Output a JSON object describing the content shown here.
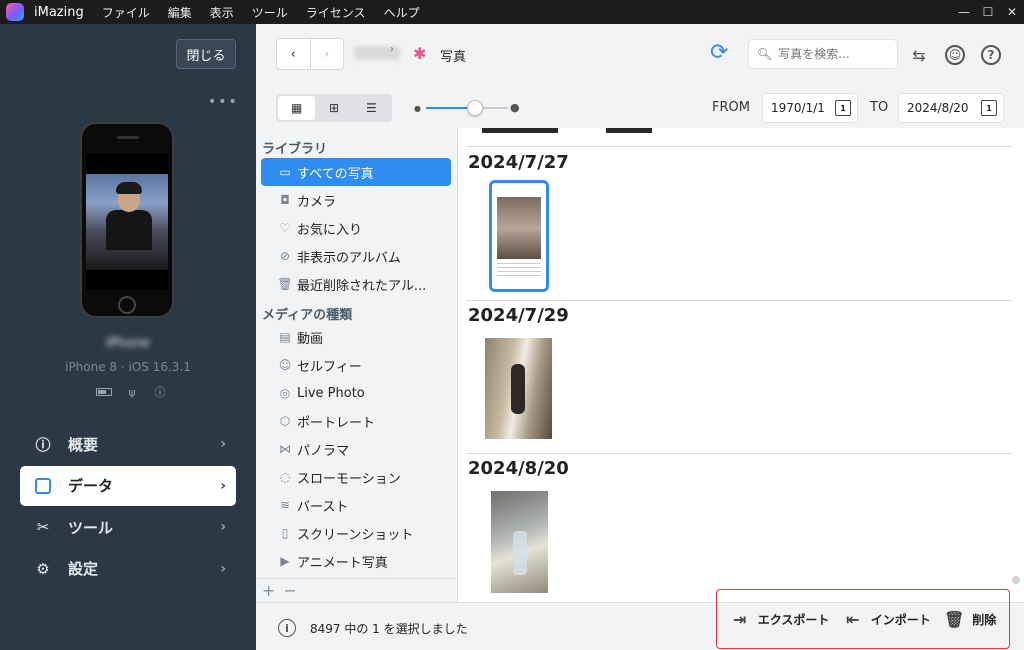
{
  "titlebar": {
    "app_name": "iMazing",
    "menu": [
      "ファイル",
      "編集",
      "表示",
      "ツール",
      "ライセンス",
      "ヘルプ"
    ]
  },
  "sidebar": {
    "close_label": "閉じる",
    "more_label": "•••",
    "device_name": "iPhone",
    "device_model": "iPhone 8 · iOS 16.3.1",
    "nav": [
      {
        "label": "概要",
        "icon": "info-icon"
      },
      {
        "label": "データ",
        "icon": "square-icon"
      },
      {
        "label": "ツール",
        "icon": "tools-icon"
      },
      {
        "label": "設定",
        "icon": "gear-icon"
      }
    ]
  },
  "toolbar": {
    "back": "‹",
    "forward": "›",
    "crumb_sep": "›",
    "crumb_title": "写真",
    "search_placeholder": "写真を検索..."
  },
  "filters": {
    "from_label": "FROM",
    "from_date": "1970/1/1",
    "to_label": "TO",
    "to_date": "2024/8/20",
    "calendar_day": "1",
    "zoom_fraction": 0.6
  },
  "albums": {
    "library_title": "ライブラリ",
    "library": [
      {
        "label": "すべての写真",
        "icon": "photo-icon"
      },
      {
        "label": "カメラ",
        "icon": "camera-icon"
      },
      {
        "label": "お気に入り",
        "icon": "heart-icon"
      },
      {
        "label": "非表示のアルバム",
        "icon": "eye-slash-icon"
      },
      {
        "label": "最近削除されたアル...",
        "icon": "trash-icon"
      }
    ],
    "media_title": "メディアの種類",
    "media": [
      {
        "label": "動画",
        "icon": "video-icon"
      },
      {
        "label": "セルフィー",
        "icon": "selfie-icon"
      },
      {
        "label": "Live Photo",
        "icon": "live-photo-icon"
      },
      {
        "label": "ポートレート",
        "icon": "cube-icon"
      },
      {
        "label": "パノラマ",
        "icon": "panorama-icon"
      },
      {
        "label": "スローモーション",
        "icon": "slowmo-icon"
      },
      {
        "label": "バースト",
        "icon": "burst-icon"
      },
      {
        "label": "スクリーンショット",
        "icon": "phone-icon"
      },
      {
        "label": "アニメート写真",
        "icon": "animated-icon"
      }
    ],
    "add": "+",
    "remove": "−"
  },
  "photos": {
    "groups": [
      {
        "date": "2024/7/27"
      },
      {
        "date": "2024/7/29"
      },
      {
        "date": "2024/8/20"
      }
    ]
  },
  "status": {
    "text": "8497 中の 1 を選択しました",
    "export_label": "エクスポート",
    "import_label": "インポート",
    "delete_label": "削除"
  },
  "colors": {
    "accent": "#2f8cf0",
    "sidebar_bg": "#2c3845",
    "highlight": "#e53935"
  }
}
